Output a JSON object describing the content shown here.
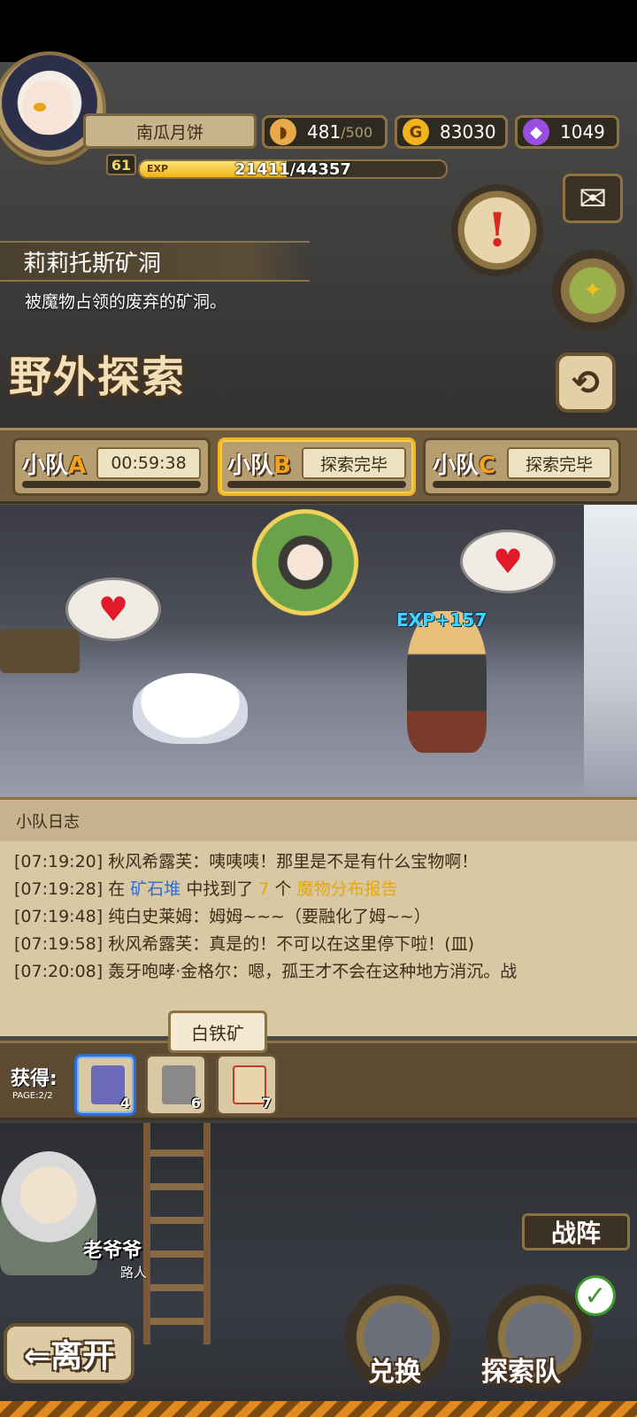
{
  "player": {
    "name": "南瓜月饼",
    "level": "61",
    "exp_tag": "EXP",
    "exp_text": "21411/44357",
    "exp_progress": 0.48
  },
  "resources": {
    "stamina": {
      "value": "481",
      "max": "/500",
      "icon": "bread-icon"
    },
    "gold": {
      "value": "83030",
      "icon": "gold-coin-icon",
      "symbol": "G"
    },
    "gems": {
      "value": "1049",
      "icon": "purple-gem-icon"
    }
  },
  "location": {
    "name": "莉莉托斯矿洞",
    "description": "被魔物占领的废弃的矿洞。"
  },
  "page_title": "野外探索",
  "teams": [
    {
      "prefix": "小队",
      "letter": "A",
      "status": "00:59:38",
      "active": false
    },
    {
      "prefix": "小队",
      "letter": "B",
      "status": "探索完毕",
      "active": true
    },
    {
      "prefix": "小队",
      "letter": "C",
      "status": "探索完毕",
      "active": false
    }
  ],
  "scene": {
    "exp_popup": "EXP+157"
  },
  "log": {
    "title": "小队日志",
    "lines": [
      {
        "time": "[07:19:20]",
        "text": " 秋风希露芙：咦咦咦！那里是不是有什么宝物啊！"
      },
      {
        "time": "[07:19:28]",
        "pre": " 在 ",
        "place": "矿石堆",
        "mid": " 中找到了 ",
        "count": "7",
        "mid2": " 个 ",
        "item": "魔物分布报告"
      },
      {
        "time": "[07:19:48]",
        "text": " 纯白史莱姆：姆姆~~~（要融化了姆~~）"
      },
      {
        "time": "[07:19:58]",
        "text": " 秋风希露芙：真是的！不可以在这里停下啦！(皿)"
      },
      {
        "time": "[07:20:08]",
        "text": " 轰牙咆哮·金格尔：嗯，孤王才不会在这种地方消沉。战"
      }
    ]
  },
  "loot": {
    "label": "获得:",
    "page": "PAGE:2/2",
    "tooltip": "白铁矿",
    "items": [
      {
        "name": "blue-ore",
        "count": "4",
        "color": "#6a6ab8",
        "selected": true
      },
      {
        "name": "white-iron-ore",
        "count": "6",
        "color": "#8a8888",
        "selected": false
      },
      {
        "name": "report-scroll",
        "count": "7",
        "color": "#e8d5ad",
        "selected": false
      }
    ]
  },
  "npc": {
    "name": "老爷爷",
    "role": "路人"
  },
  "buttons": {
    "formation": "战阵",
    "leave": "⇐离开",
    "exchange": "兑换",
    "explore_team": "探索队",
    "back_icon": "⟲",
    "mail_icon": "✉",
    "quest_icon": "!",
    "check_icon": "✓"
  },
  "colors": {
    "accent_gold": "#f0b424",
    "highlight_blue": "#2d6fd2",
    "highlight_yellow": "#e8a70c",
    "panel": "#d8c8a4"
  }
}
